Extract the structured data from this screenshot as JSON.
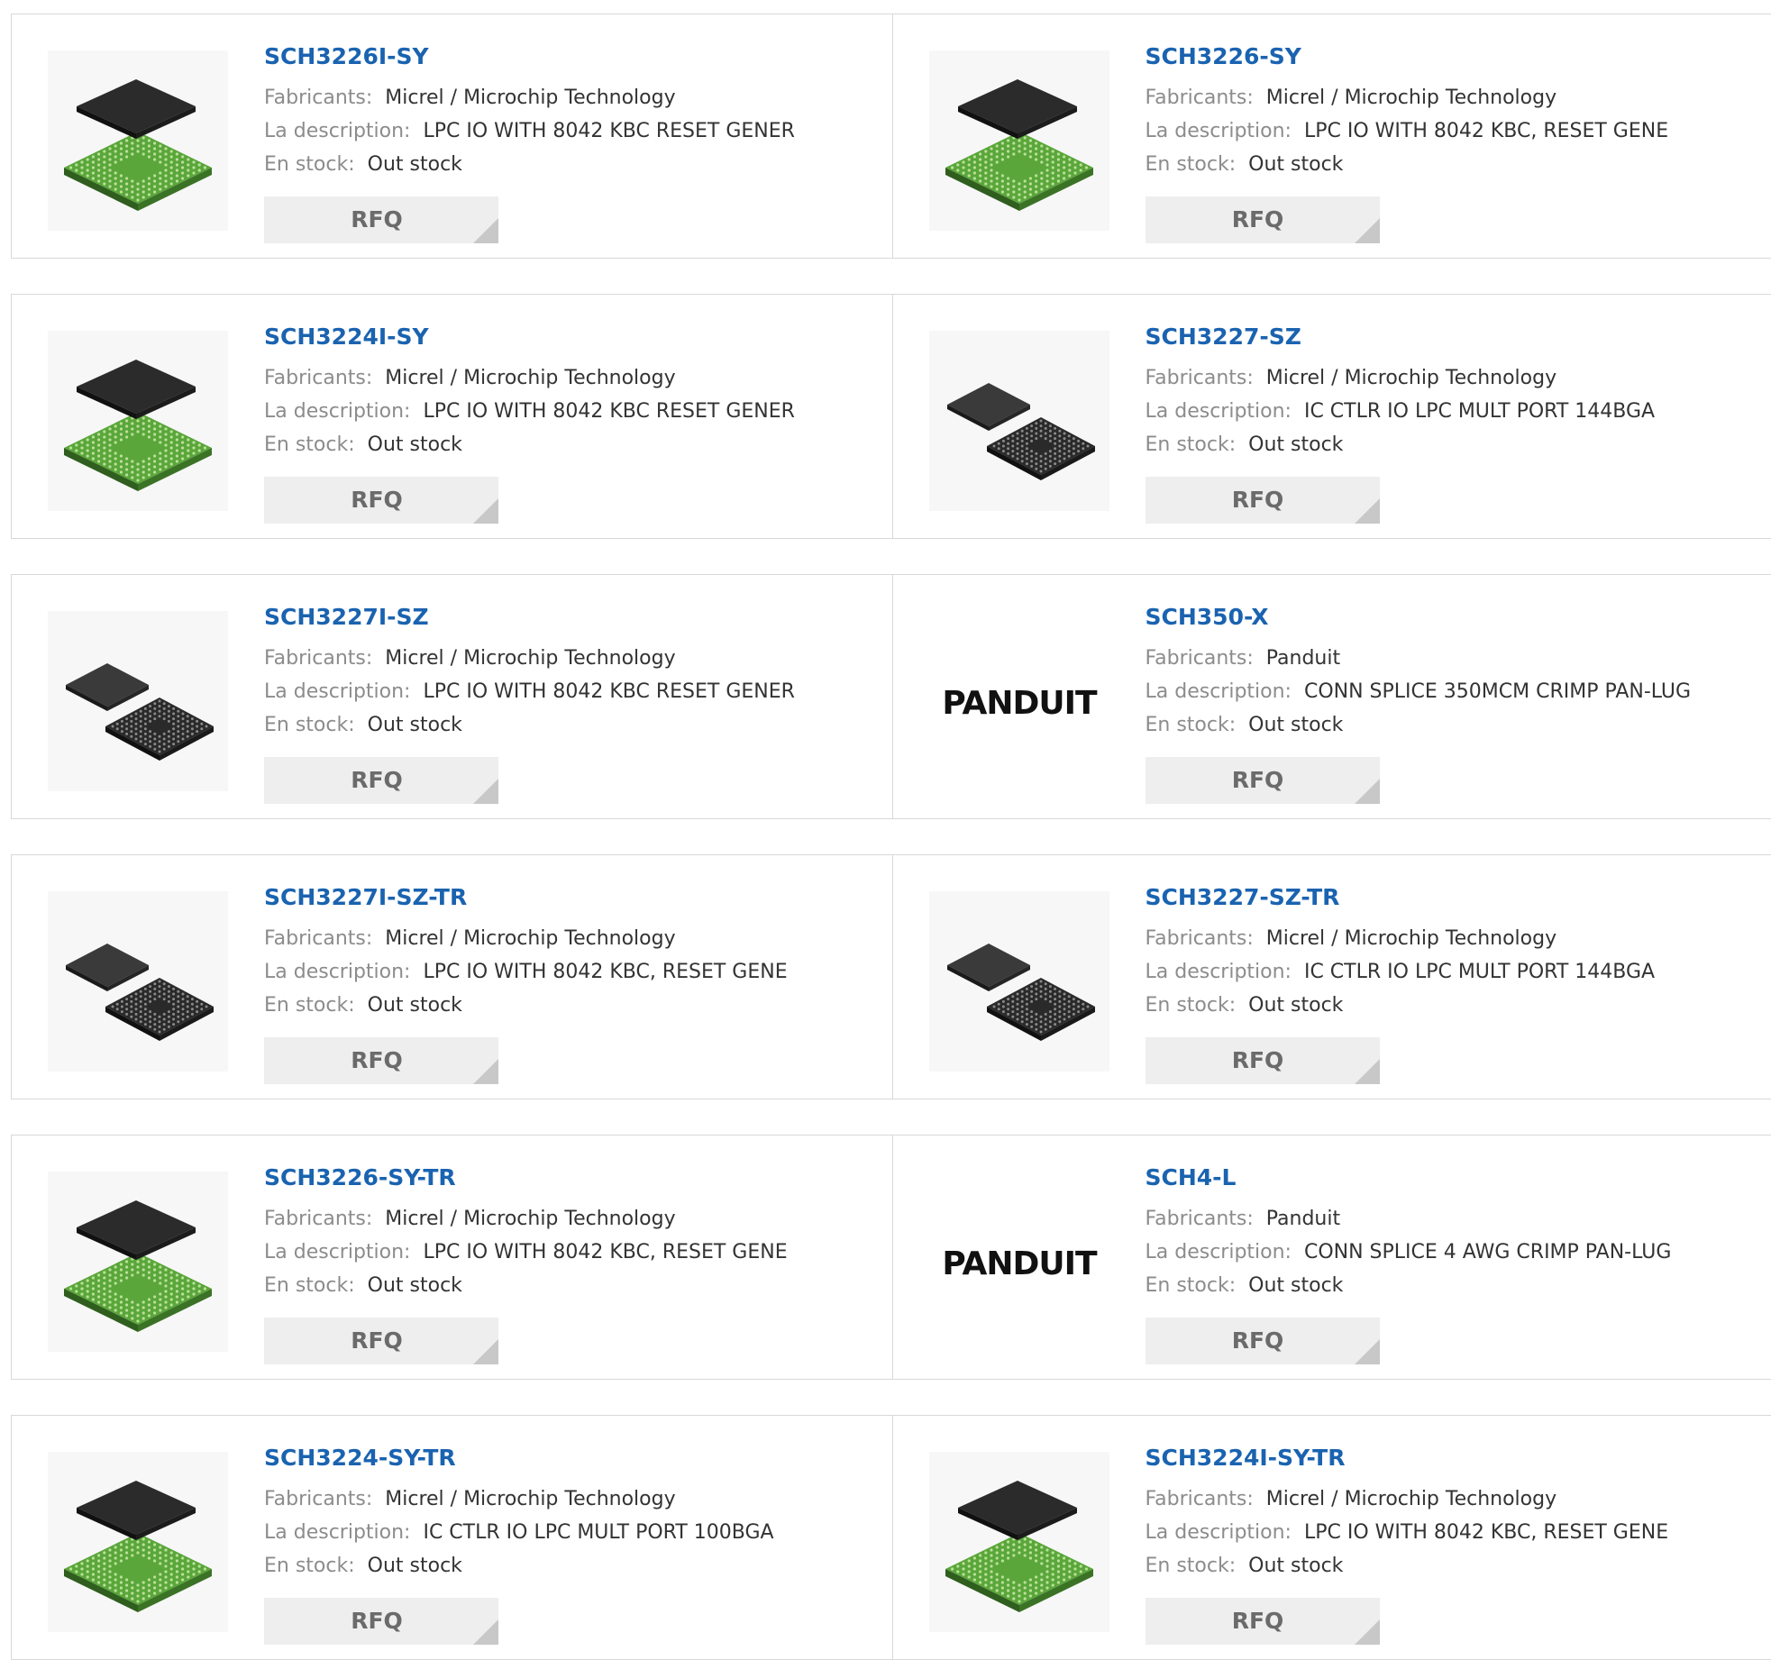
{
  "labels": {
    "manufacturer": "Fabricants:",
    "description": "La description:",
    "stock": "En stock:",
    "rfq": "RFQ"
  },
  "products": [
    {
      "part": "SCH3226I-SY",
      "manufacturer": "Micrel / Microchip Technology",
      "description": "LPC IO WITH 8042 KBC RESET GENER",
      "stock": "Out stock",
      "image": "bga-green-chip-icon"
    },
    {
      "part": "SCH3226-SY",
      "manufacturer": "Micrel / Microchip Technology",
      "description": "LPC IO WITH 8042 KBC, RESET GENE",
      "stock": "Out stock",
      "image": "bga-green-chip-icon"
    },
    {
      "part": "SCH3224I-SY",
      "manufacturer": "Micrel / Microchip Technology",
      "description": "LPC IO WITH 8042 KBC RESET GENER",
      "stock": "Out stock",
      "image": "bga-green-chip-icon"
    },
    {
      "part": "SCH3227-SZ",
      "manufacturer": "Micrel / Microchip Technology",
      "description": "IC CTLR IO LPC MULT PORT 144BGA",
      "stock": "Out stock",
      "image": "bga-black-chip-icon"
    },
    {
      "part": "SCH3227I-SZ",
      "manufacturer": "Micrel / Microchip Technology",
      "description": "LPC IO WITH 8042 KBC RESET GENER",
      "stock": "Out stock",
      "image": "bga-black-chip-icon"
    },
    {
      "part": "SCH350-X",
      "manufacturer": "Panduit",
      "description": "CONN SPLICE 350MCM CRIMP PAN-LUG",
      "stock": "Out stock",
      "image": "panduit-logo"
    },
    {
      "part": "SCH3227I-SZ-TR",
      "manufacturer": "Micrel / Microchip Technology",
      "description": "LPC IO WITH 8042 KBC, RESET GENE",
      "stock": "Out stock",
      "image": "bga-black-chip-icon"
    },
    {
      "part": "SCH3227-SZ-TR",
      "manufacturer": "Micrel / Microchip Technology",
      "description": "IC CTLR IO LPC MULT PORT 144BGA",
      "stock": "Out stock",
      "image": "bga-black-chip-icon"
    },
    {
      "part": "SCH3226-SY-TR",
      "manufacturer": "Micrel / Microchip Technology",
      "description": "LPC IO WITH 8042 KBC, RESET GENE",
      "stock": "Out stock",
      "image": "bga-green-chip-icon"
    },
    {
      "part": "SCH4-L",
      "manufacturer": "Panduit",
      "description": "CONN SPLICE 4 AWG CRIMP PAN-LUG",
      "stock": "Out stock",
      "image": "panduit-logo"
    },
    {
      "part": "SCH3224-SY-TR",
      "manufacturer": "Micrel / Microchip Technology",
      "description": "IC CTLR IO LPC MULT PORT 100BGA",
      "stock": "Out stock",
      "image": "bga-green-chip-icon"
    },
    {
      "part": "SCH3224I-SY-TR",
      "manufacturer": "Micrel / Microchip Technology",
      "description": "LPC IO WITH 8042 KBC, RESET GENE",
      "stock": "Out stock",
      "image": "bga-green-chip-icon"
    }
  ],
  "colors": {
    "part_link": "#1a63b0",
    "label": "#8c8c8c",
    "rfq_bg": "#eeeeee",
    "chip_green": "#5aa63a",
    "chip_dark": "#2b2b2b"
  },
  "panduit_logo_text": "PANDUIT"
}
